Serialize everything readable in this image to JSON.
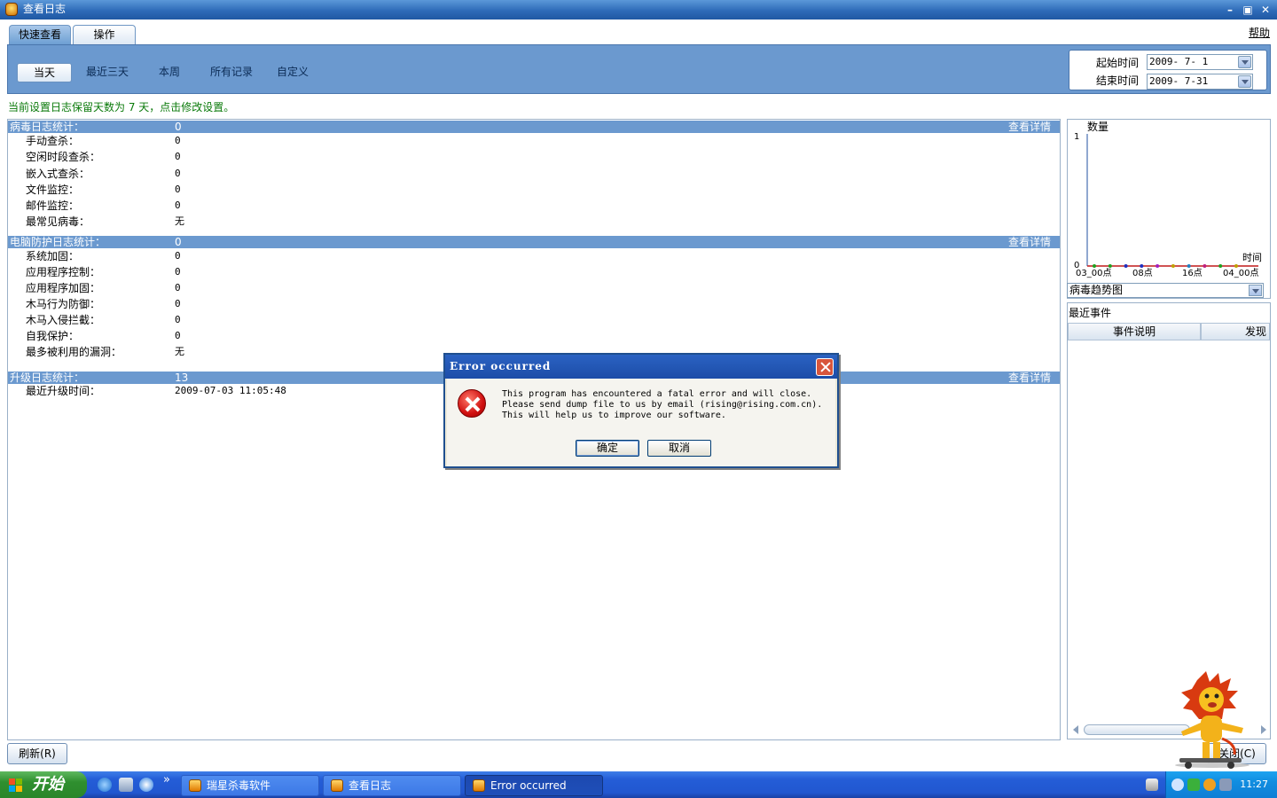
{
  "window": {
    "title": "查看日志"
  },
  "tabs": [
    {
      "label": "快速查看"
    },
    {
      "label": "操作"
    }
  ],
  "help_label": "帮助",
  "filters": [
    "当天",
    "最近三天",
    "本周",
    "所有记录",
    "自定义"
  ],
  "date_range": {
    "start_label": "起始时间",
    "start_value": "2009- 7- 1",
    "end_label": "结束时间",
    "end_value": "2009- 7-31"
  },
  "notice": "当前设置日志保留天数为 7 天，点击修改设置。",
  "sections": {
    "virus": {
      "title": "病毒日志统计：",
      "value": "0",
      "detail": "查看详情",
      "rows": [
        {
          "label": "手动查杀：",
          "value": "0"
        },
        {
          "label": "空闲时段查杀：",
          "value": "0"
        },
        {
          "label": "嵌入式查杀：",
          "value": "0"
        },
        {
          "label": "文件监控：",
          "value": "0"
        },
        {
          "label": "邮件监控：",
          "value": "0"
        },
        {
          "label": "最常见病毒：",
          "value": "无"
        }
      ]
    },
    "protect": {
      "title": "电脑防护日志统计：",
      "value": "0",
      "detail": "查看详情",
      "rows": [
        {
          "label": "系统加固：",
          "value": "0"
        },
        {
          "label": "应用程序控制：",
          "value": "0"
        },
        {
          "label": "应用程序加固：",
          "value": "0"
        },
        {
          "label": "木马行为防御：",
          "value": "0"
        },
        {
          "label": "木马入侵拦截：",
          "value": "0"
        },
        {
          "label": "自我保护：",
          "value": "0"
        },
        {
          "label": "最多被利用的漏洞：",
          "value": "无"
        }
      ]
    },
    "upgrade": {
      "title": "升级日志统计：",
      "value": "13",
      "detail": "查看详情",
      "rows": [
        {
          "label": "最近升级时间：",
          "value": "2009-07-03 11:05:48"
        }
      ]
    }
  },
  "chart_data": {
    "type": "line",
    "ylabel": "数量",
    "xlabel": "时间",
    "yticks": [
      "1",
      "0"
    ],
    "ylim": [
      0,
      1
    ],
    "xticks": [
      "03_00点",
      "08点",
      "16点",
      "04_00点"
    ],
    "points": [
      0,
      0,
      0,
      0,
      0,
      0,
      0,
      0,
      0,
      0,
      0,
      0,
      0,
      0,
      0,
      0,
      0,
      0,
      0,
      0
    ],
    "point_colors": [
      "#20a020",
      "#20a020",
      "#2030c0",
      "#2030c0",
      "#a020c0",
      "#c0a000",
      "#2080c0",
      "#c02080",
      "#20a020",
      "#c0a000"
    ],
    "grid": false
  },
  "chart_select": "病毒趋势图",
  "events": {
    "title": "最近事件",
    "columns": [
      "事件说明",
      "发现"
    ]
  },
  "refresh_button": "刷新(R)",
  "close_button": "关闭(C)",
  "dialog": {
    "title": "Error occurred",
    "lines": [
      "This program has encountered a fatal error and will close.",
      "Please send dump file to us by email (rising@rising.com.cn).",
      "This will help us to improve our software."
    ],
    "ok": "确定",
    "cancel": "取消"
  },
  "taskbar": {
    "start": "开始",
    "more": "»",
    "tasks": [
      "瑞星杀毒软件",
      "查看日志",
      "Error occurred"
    ],
    "clock": "11:27"
  }
}
